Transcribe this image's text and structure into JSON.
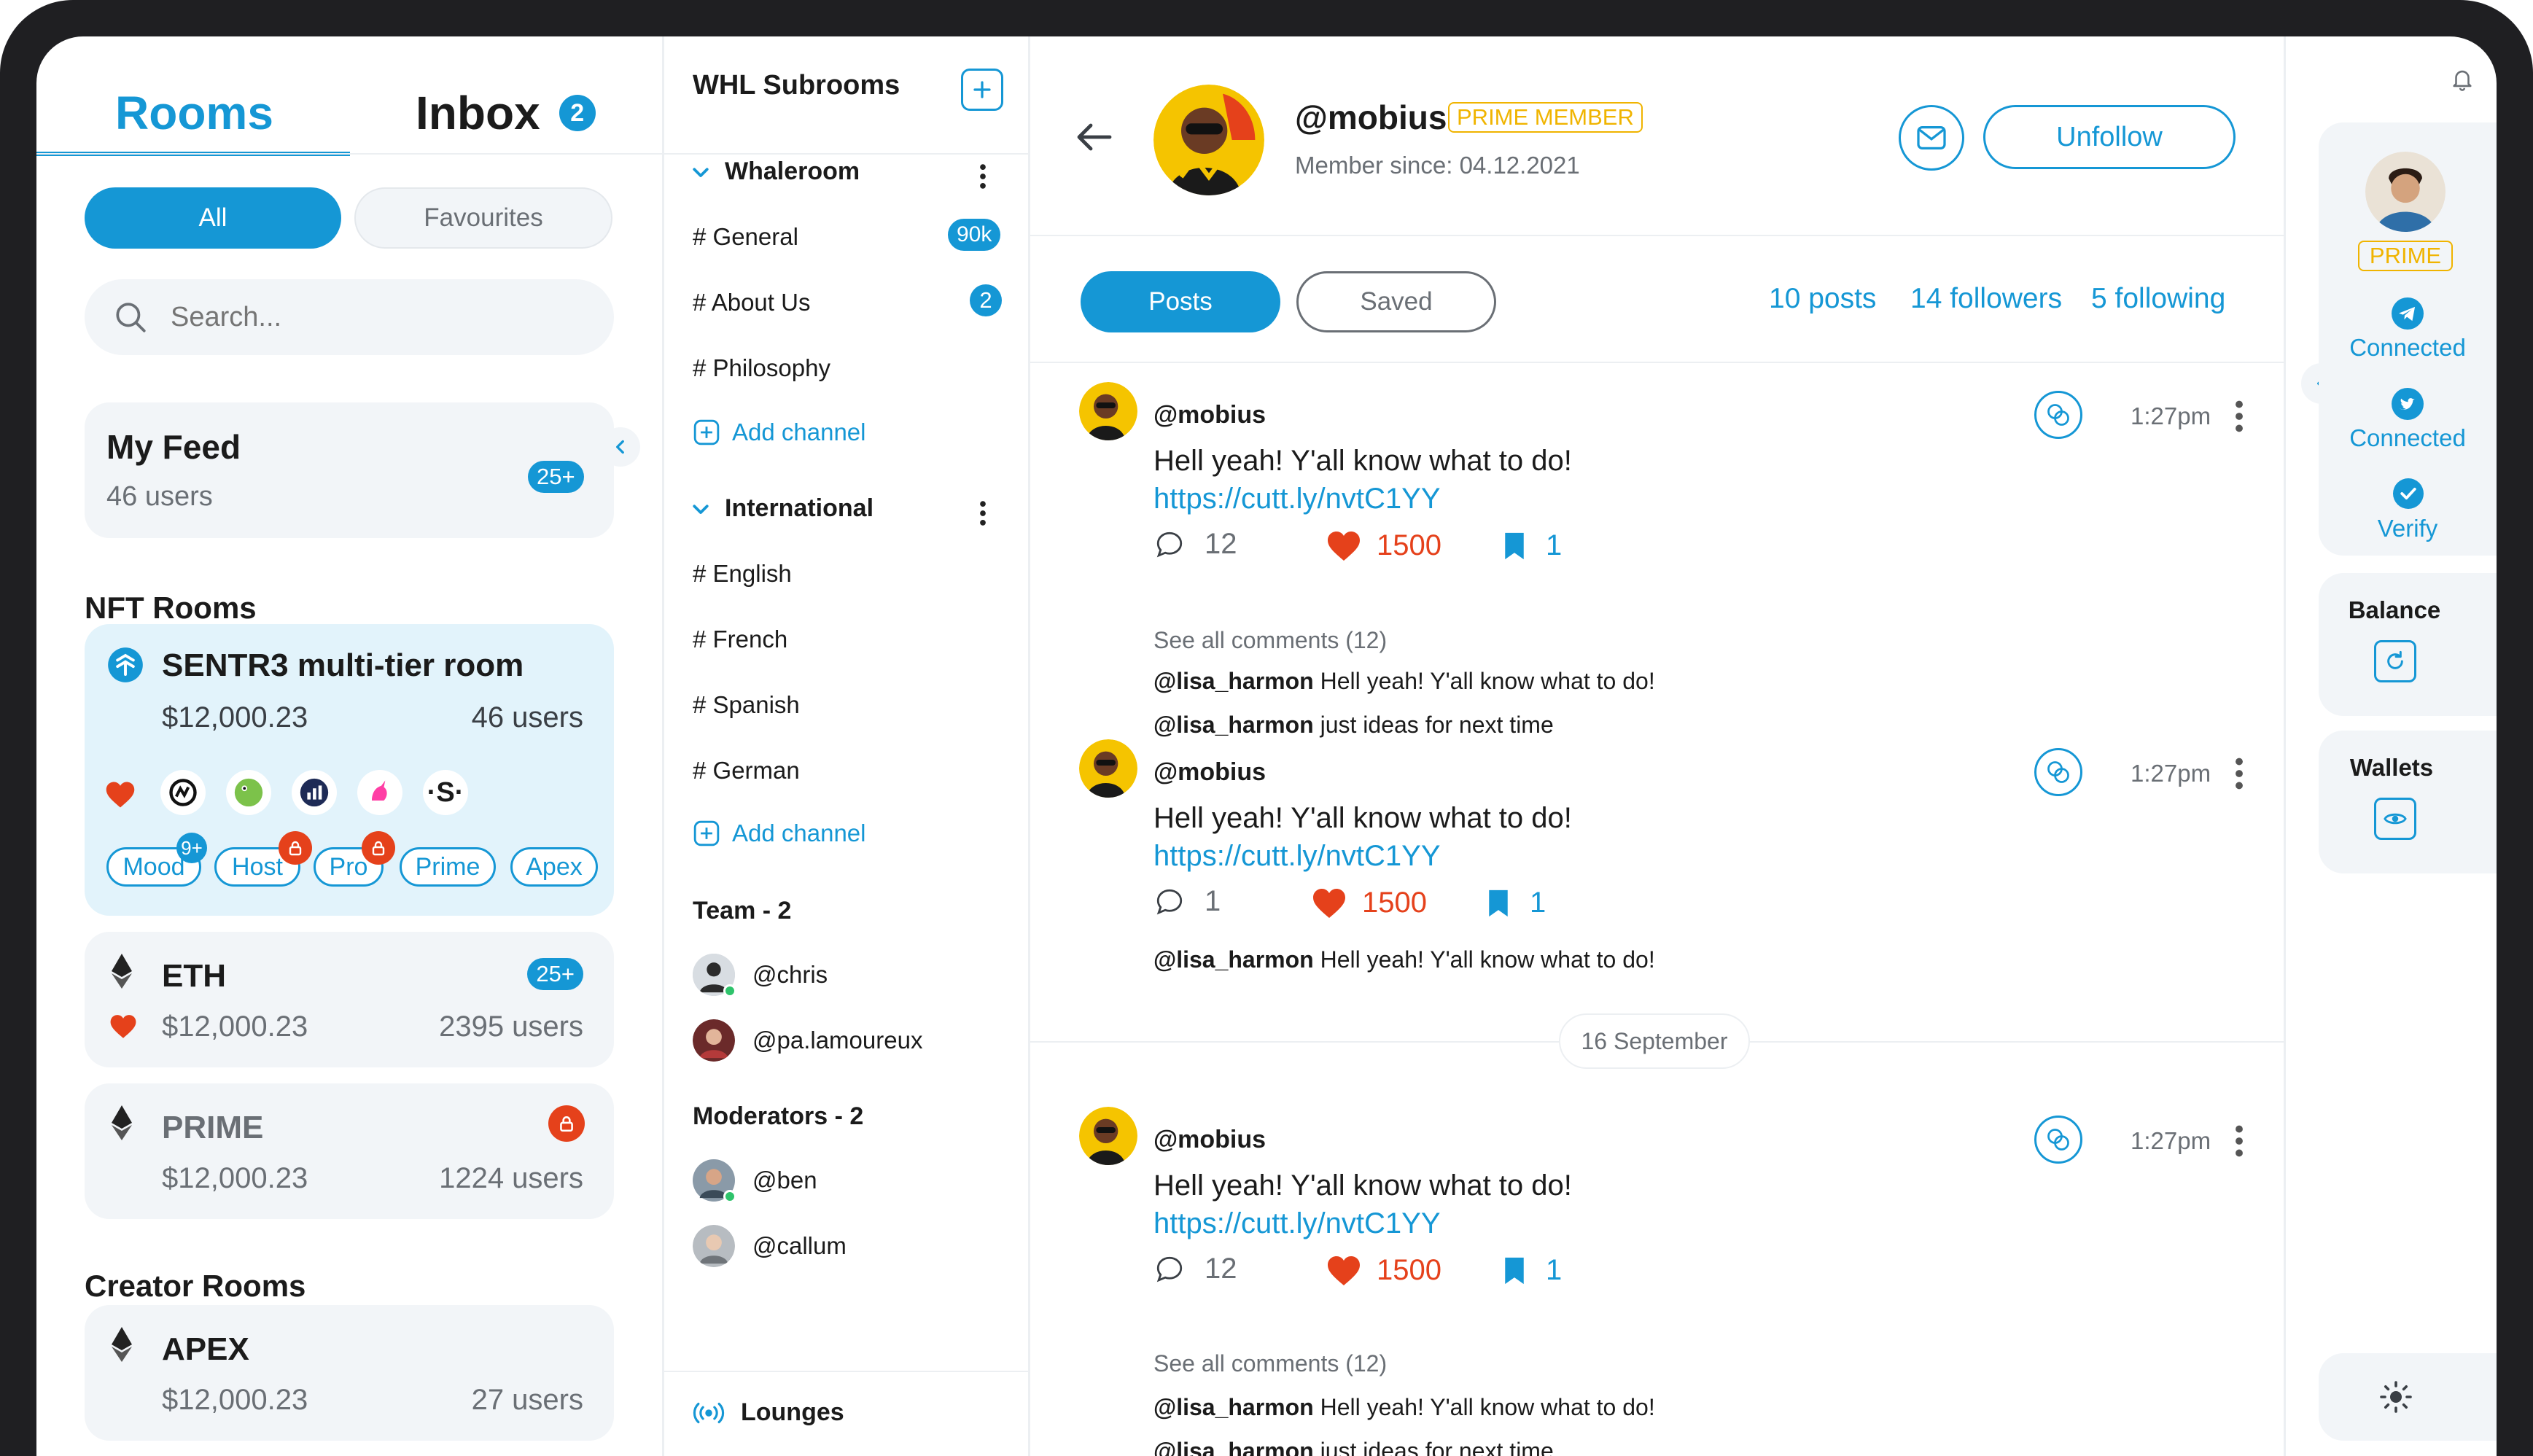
{
  "tabs": {
    "rooms": "Rooms",
    "inbox": "Inbox",
    "inbox_count": "2"
  },
  "filters": {
    "all": "All",
    "favourites": "Favourites"
  },
  "search": {
    "placeholder": "Search..."
  },
  "my_feed": {
    "title": "My Feed",
    "users": "46 users",
    "badge": "25+"
  },
  "nft_rooms": {
    "heading": "NFT Rooms",
    "sentr3": {
      "name": "SENTR3 multi-tier room",
      "price": "$12,000.23",
      "users": "46 users"
    },
    "tags": [
      {
        "label": "Mood",
        "badge": "9+"
      },
      {
        "label": "Host"
      },
      {
        "label": "Pro"
      },
      {
        "label": "Prime"
      },
      {
        "label": "Apex"
      }
    ],
    "eth": {
      "name": "ETH",
      "price": "$12,000.23",
      "users": "2395 users",
      "badge": "25+"
    },
    "prime": {
      "name": "PRIME",
      "price": "$12,000.23",
      "users": "1224 users"
    }
  },
  "creator_rooms": {
    "heading": "Creator Rooms",
    "apex": {
      "name": "APEX",
      "price": "$12,000.23",
      "users": "27 users"
    }
  },
  "subrooms": {
    "title": "WHL Subrooms",
    "whaleroom": {
      "name": "Whaleroom",
      "channels": [
        {
          "label": "# General",
          "badge": "90k"
        },
        {
          "label": "# About Us",
          "badge": "2"
        },
        {
          "label": "# Philosophy"
        }
      ],
      "add": "Add channel"
    },
    "international": {
      "name": "International",
      "channels": [
        {
          "label": "# English"
        },
        {
          "label": "# French"
        },
        {
          "label": "# Spanish"
        },
        {
          "label": "# German"
        }
      ],
      "add": "Add channel"
    },
    "team": {
      "heading": "Team - 2",
      "members": [
        "@chris",
        "@pa.lamoureux"
      ]
    },
    "moderators": {
      "heading": "Moderators - 2",
      "members": [
        "@ben",
        "@callum"
      ]
    },
    "lounges": "Lounges"
  },
  "profile": {
    "handle": "@mobius",
    "badge": "PRIME MEMBER",
    "since": "Member since: 04.12.2021",
    "unfollow": "Unfollow",
    "tab_posts": "Posts",
    "tab_saved": "Saved",
    "posts": "10 posts",
    "followers": "14 followers",
    "following": "5 following"
  },
  "posts": [
    {
      "author": "@mobius",
      "time": "1:27pm",
      "text": "Hell yeah! Y'all know what to do!",
      "link": "https://cutt.ly/nvtC1YY",
      "comments": "12",
      "likes": "1500",
      "saves": "1",
      "see_all": "See all comments (12)",
      "replies": [
        {
          "user": "@lisa_harmon",
          "text": "Hell yeah! Y'all know what to do!"
        },
        {
          "user": "@lisa_harmon",
          "text": "just ideas for next time"
        }
      ]
    },
    {
      "author": "@mobius",
      "time": "1:27pm",
      "text": "Hell yeah! Y'all know what to do!",
      "link": "https://cutt.ly/nvtC1YY",
      "comments": "1",
      "likes": "1500",
      "saves": "1",
      "replies": [
        {
          "user": "@lisa_harmon",
          "text": "Hell yeah! Y'all know what to do!"
        }
      ]
    },
    {
      "author": "@mobius",
      "time": "1:27pm",
      "text": "Hell yeah! Y'all know what to do!",
      "link": "https://cutt.ly/nvtC1YY",
      "comments": "12",
      "likes": "1500",
      "saves": "1",
      "see_all": "See all comments (12)",
      "replies": [
        {
          "user": "@lisa_harmon",
          "text": "Hell yeah! Y'all know what to do!"
        },
        {
          "user": "@lisa_harmon",
          "text": "just ideas for next time"
        }
      ]
    }
  ],
  "date_divider": "16 September",
  "right_panel": {
    "prime": "PRIME",
    "telegram": "Connected",
    "twitter": "Connected",
    "verify": "Verify",
    "balance": "Balance",
    "wallets": "Wallets"
  },
  "colors": {
    "accent": "#1597d5",
    "like": "#e5411b",
    "lock": "#e5411b",
    "prime": "#f0b400"
  }
}
